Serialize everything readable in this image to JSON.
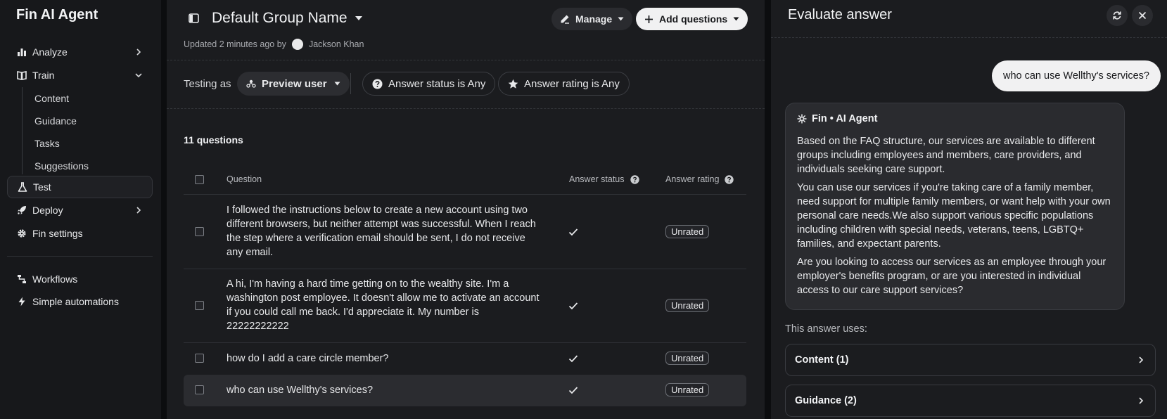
{
  "sidebar": {
    "title": "Fin AI Agent",
    "items": {
      "analyze": "Analyze",
      "train": "Train",
      "test": "Test",
      "deploy": "Deploy",
      "fin_settings": "Fin settings",
      "workflows": "Workflows",
      "simple_automations": "Simple automations"
    },
    "train_sub": {
      "content": "Content",
      "guidance": "Guidance",
      "tasks": "Tasks",
      "suggestions": "Suggestions"
    }
  },
  "main": {
    "group_name": "Default Group Name",
    "manage_label": "Manage",
    "add_questions_label": "Add questions",
    "updated_prefix": "Updated 2 minutes ago by",
    "updated_by": "Jackson Khan",
    "testing_as_label": "Testing as",
    "preview_user": "Preview user",
    "filter_status": "Answer status is Any",
    "filter_rating": "Answer rating is Any",
    "question_count": "11 questions",
    "columns": {
      "question": "Question",
      "answer_status": "Answer status",
      "answer_rating": "Answer rating"
    },
    "rows": [
      {
        "question": "I followed the instructions below to create a new account using two different browsers, but neither attempt was successful. When I reach the step where a verification email should be sent, I do not receive any email.",
        "rating": "Unrated"
      },
      {
        "question": "A hi, I'm having a hard time getting on to the wealthy site. I'm a washington post employee. It doesn't allow me to activate an account if you could call me back. I'd appreciate it. My number is 22222222222",
        "rating": "Unrated"
      },
      {
        "question": "how do I add a care circle member?",
        "rating": "Unrated"
      },
      {
        "question": "who can use Wellthy's services?",
        "rating": "Unrated"
      }
    ]
  },
  "panel": {
    "title": "Evaluate answer",
    "user_message": "who can use Wellthy's services?",
    "agent_name": "Fin • AI Agent",
    "agent_paragraphs": [
      "Based on the FAQ structure, our services are available to different groups including employees and members, care providers, and individuals seeking care support.",
      "You can use our services if you're taking care of a family member, need support for multiple family members, or want help with your own personal care needs.We also support various specific populations including children with special needs, veterans, teens, LGBTQ+ families, and expectant parents.",
      "Are you looking to access our services as an employee through your employer's benefits program, or are you interested in individual access to our care support services?"
    ],
    "uses_label": "This answer uses:",
    "sources": {
      "content": "Content (1)",
      "guidance": "Guidance (2)"
    }
  },
  "icons": {
    "analyze": "bar-chart-icon",
    "train": "book-icon",
    "test": "flask-icon",
    "deploy": "rocket-icon",
    "fin_settings": "gear-icon",
    "workflows": "workflow-icon",
    "simple_automations": "bolt-icon"
  }
}
